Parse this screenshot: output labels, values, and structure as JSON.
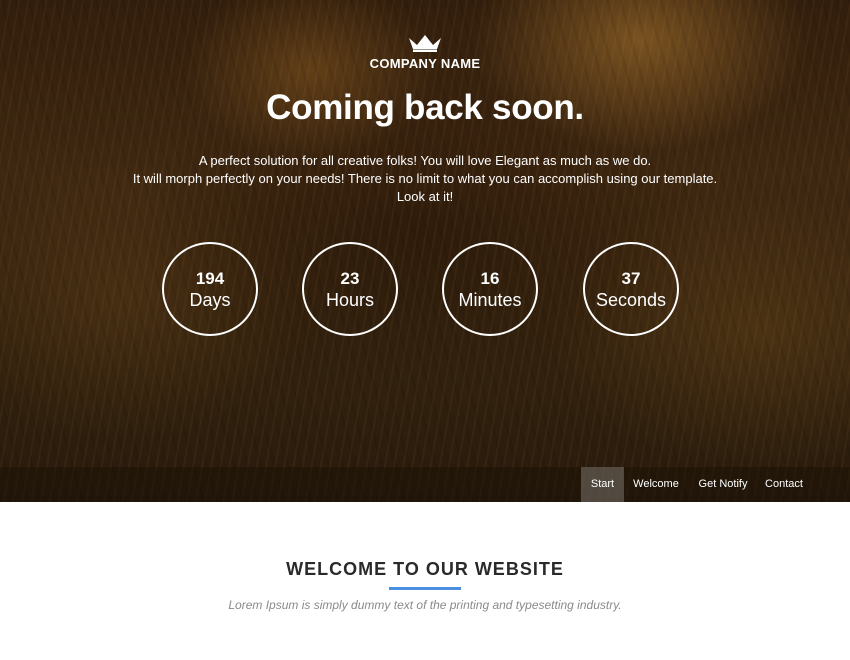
{
  "brand": {
    "name": "COMPANY NAME",
    "logo_icon": "crown-icon"
  },
  "hero": {
    "headline": "Coming back soon.",
    "intro_lines": [
      "A perfect solution for all creative folks! You will love Elegant as much as we do.",
      "It will morph perfectly on your needs! There is no limit to what you can accomplish using our template.",
      "Look at it!"
    ]
  },
  "countdown": [
    {
      "value": "194",
      "label": "Days"
    },
    {
      "value": "23",
      "label": "Hours"
    },
    {
      "value": "16",
      "label": "Minutes"
    },
    {
      "value": "37",
      "label": "Seconds"
    }
  ],
  "nav": {
    "items": [
      {
        "label": "Start",
        "active": true
      },
      {
        "label": "Welcome",
        "active": false
      },
      {
        "label": "Get Notify",
        "active": false
      },
      {
        "label": "Contact",
        "active": false
      }
    ]
  },
  "welcome": {
    "title": "WELCOME TO OUR WEBSITE",
    "subtitle": "Lorem Ipsum is simply dummy text of the printing and typesetting industry."
  },
  "colors": {
    "accent": "#4a8fe0",
    "title_text": "#2a2a2a",
    "subtitle_text": "#8a8a8a"
  }
}
